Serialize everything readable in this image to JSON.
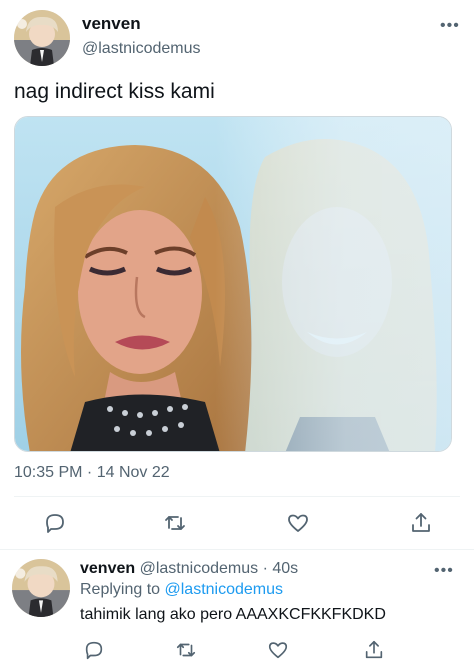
{
  "tweet": {
    "author_name": "venven",
    "author_handle": "@lastnicodemus",
    "more_icon": "•••",
    "text": "nag indirect kiss kami",
    "timestamp": "10:35 PM · 14 Nov 22",
    "actions": [
      "reply-icon",
      "retweet-icon",
      "like-icon",
      "share-icon"
    ]
  },
  "reply": {
    "author_name": "venven",
    "author_handle": "@lastnicodemus",
    "time": "· 40s",
    "replying_prefix": "Replying to",
    "replying_handle": "@lastnicodemus",
    "text": "tahimik lang ako pero AAAXKCFKKFKDKD",
    "more_icon": "•••",
    "actions": [
      "reply-icon",
      "retweet-icon",
      "like-icon",
      "share-icon"
    ]
  },
  "colors": {
    "text": "#0f1419",
    "secondary": "#536471",
    "link": "#1d9bf0",
    "divider": "#eff3f4"
  }
}
